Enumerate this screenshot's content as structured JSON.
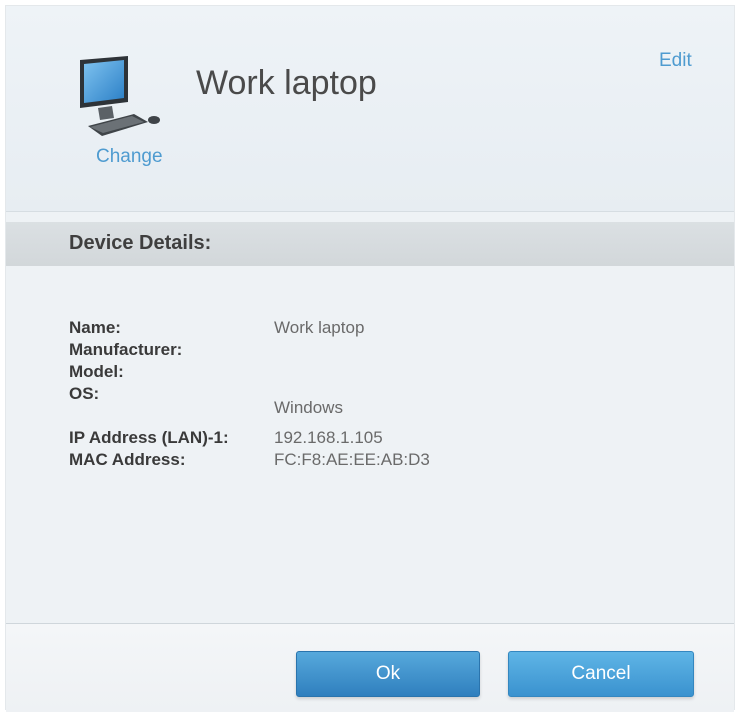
{
  "header": {
    "device_name": "Work laptop",
    "change_label": "Change",
    "edit_label": "Edit",
    "icon": "desktop-computer-icon"
  },
  "section": {
    "title": "Device Details:"
  },
  "details": [
    {
      "label": "Name:",
      "value": "Work laptop"
    },
    {
      "label": "Manufacturer:",
      "value": ""
    },
    {
      "label": "Model:",
      "value": ""
    },
    {
      "label": "OS:",
      "value": "Windows"
    },
    {
      "label": "IP Address (LAN)-1:",
      "value": "192.168.1.105"
    },
    {
      "label": "MAC Address:",
      "value": "FC:F8:AE:EE:AB:D3"
    }
  ],
  "buttons": {
    "ok_label": "Ok",
    "cancel_label": "Cancel"
  },
  "colors": {
    "link": "#4e9bd0",
    "primary_button": "#3f91cc"
  }
}
